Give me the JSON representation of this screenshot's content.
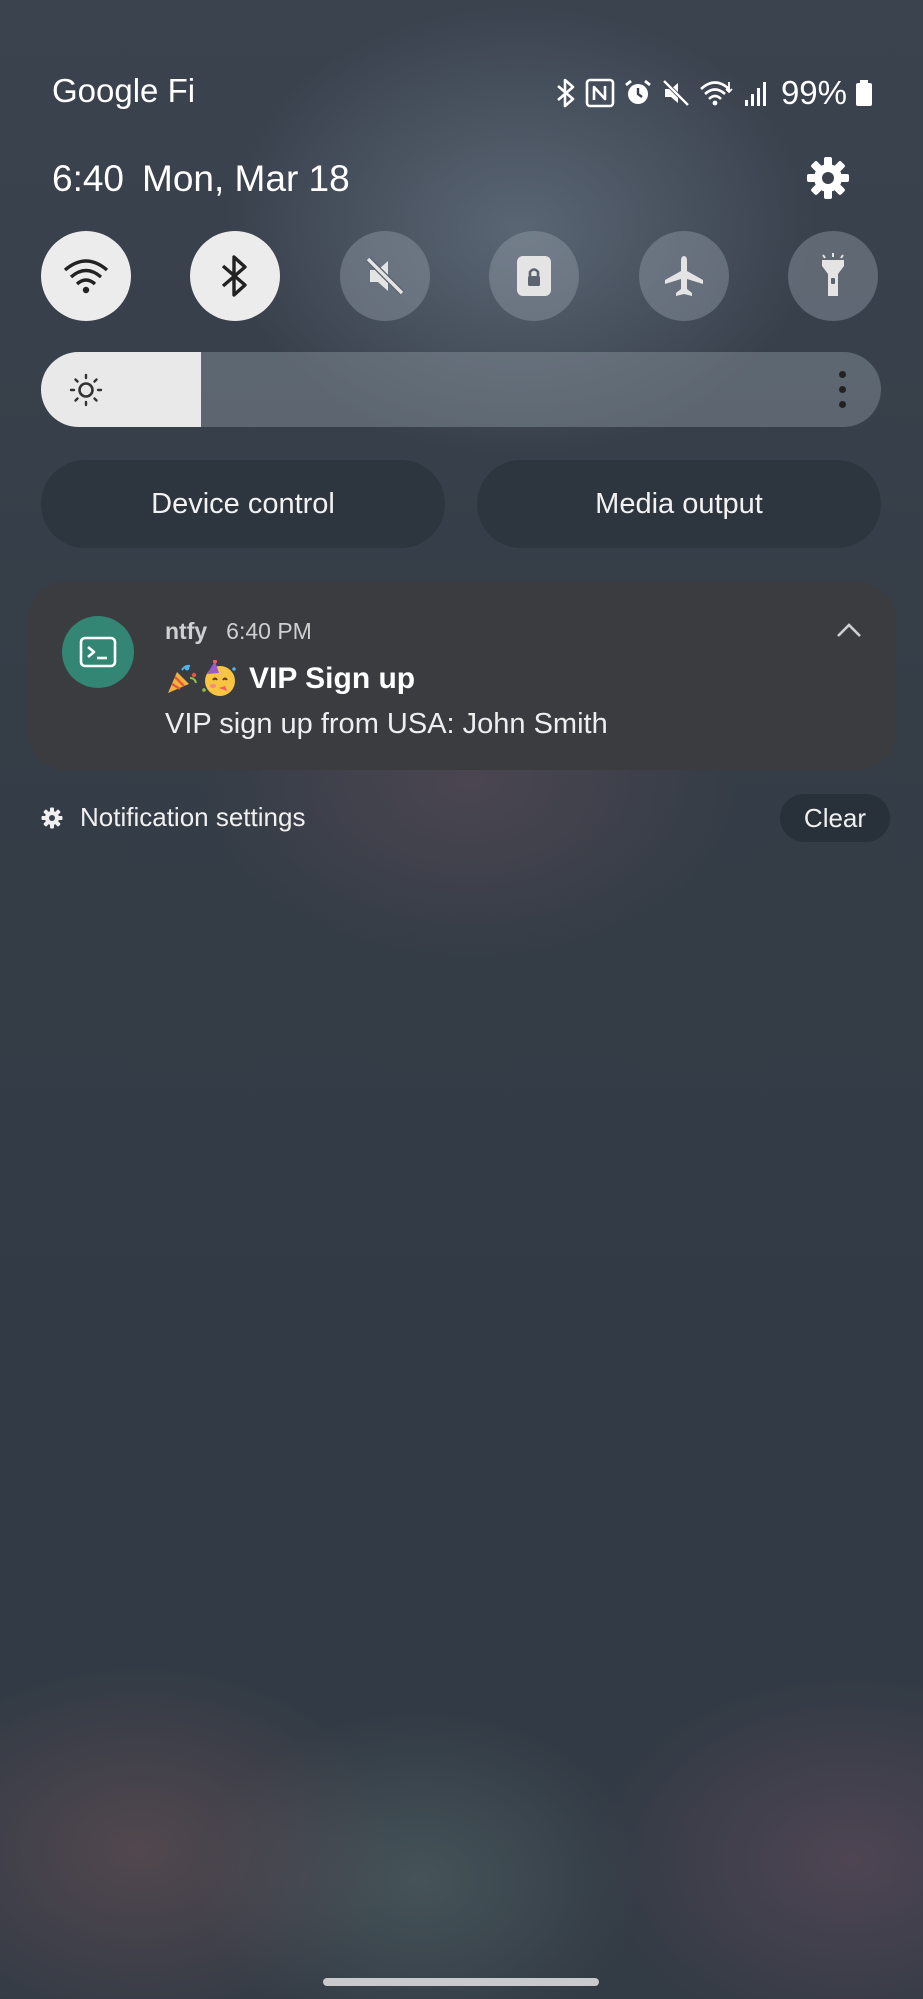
{
  "status_bar": {
    "carrier": "Google Fi",
    "battery": "99%",
    "icons": [
      "bluetooth-icon",
      "nfc-icon",
      "alarm-icon",
      "mute-icon",
      "wifi-icon",
      "signal-icon",
      "battery-icon"
    ]
  },
  "header": {
    "time": "6:40",
    "date": "Mon, Mar 18"
  },
  "quick_settings": [
    {
      "name": "wifi",
      "icon": "wifi-icon",
      "active": true
    },
    {
      "name": "bluetooth",
      "icon": "bluetooth-icon",
      "active": true
    },
    {
      "name": "sound",
      "icon": "mute-icon",
      "active": false
    },
    {
      "name": "rotation-lock",
      "icon": "lock-icon",
      "active": false
    },
    {
      "name": "airplane-mode",
      "icon": "airplane-icon",
      "active": false
    },
    {
      "name": "flashlight",
      "icon": "flashlight-icon",
      "active": false
    }
  ],
  "brightness": {
    "level": 0.19
  },
  "buttons": {
    "device_control": "Device control",
    "media_output": "Media output"
  },
  "notification": {
    "app": "ntfy",
    "time": "6:40 PM",
    "title": "VIP Sign up",
    "title_emojis": [
      "party-popper-icon",
      "partying-face-icon"
    ],
    "body": "VIP sign up from USA: John Smith",
    "app_icon": "terminal-icon",
    "accent_color": "#338574"
  },
  "footer": {
    "settings_label": "Notification settings",
    "clear_label": "Clear"
  }
}
